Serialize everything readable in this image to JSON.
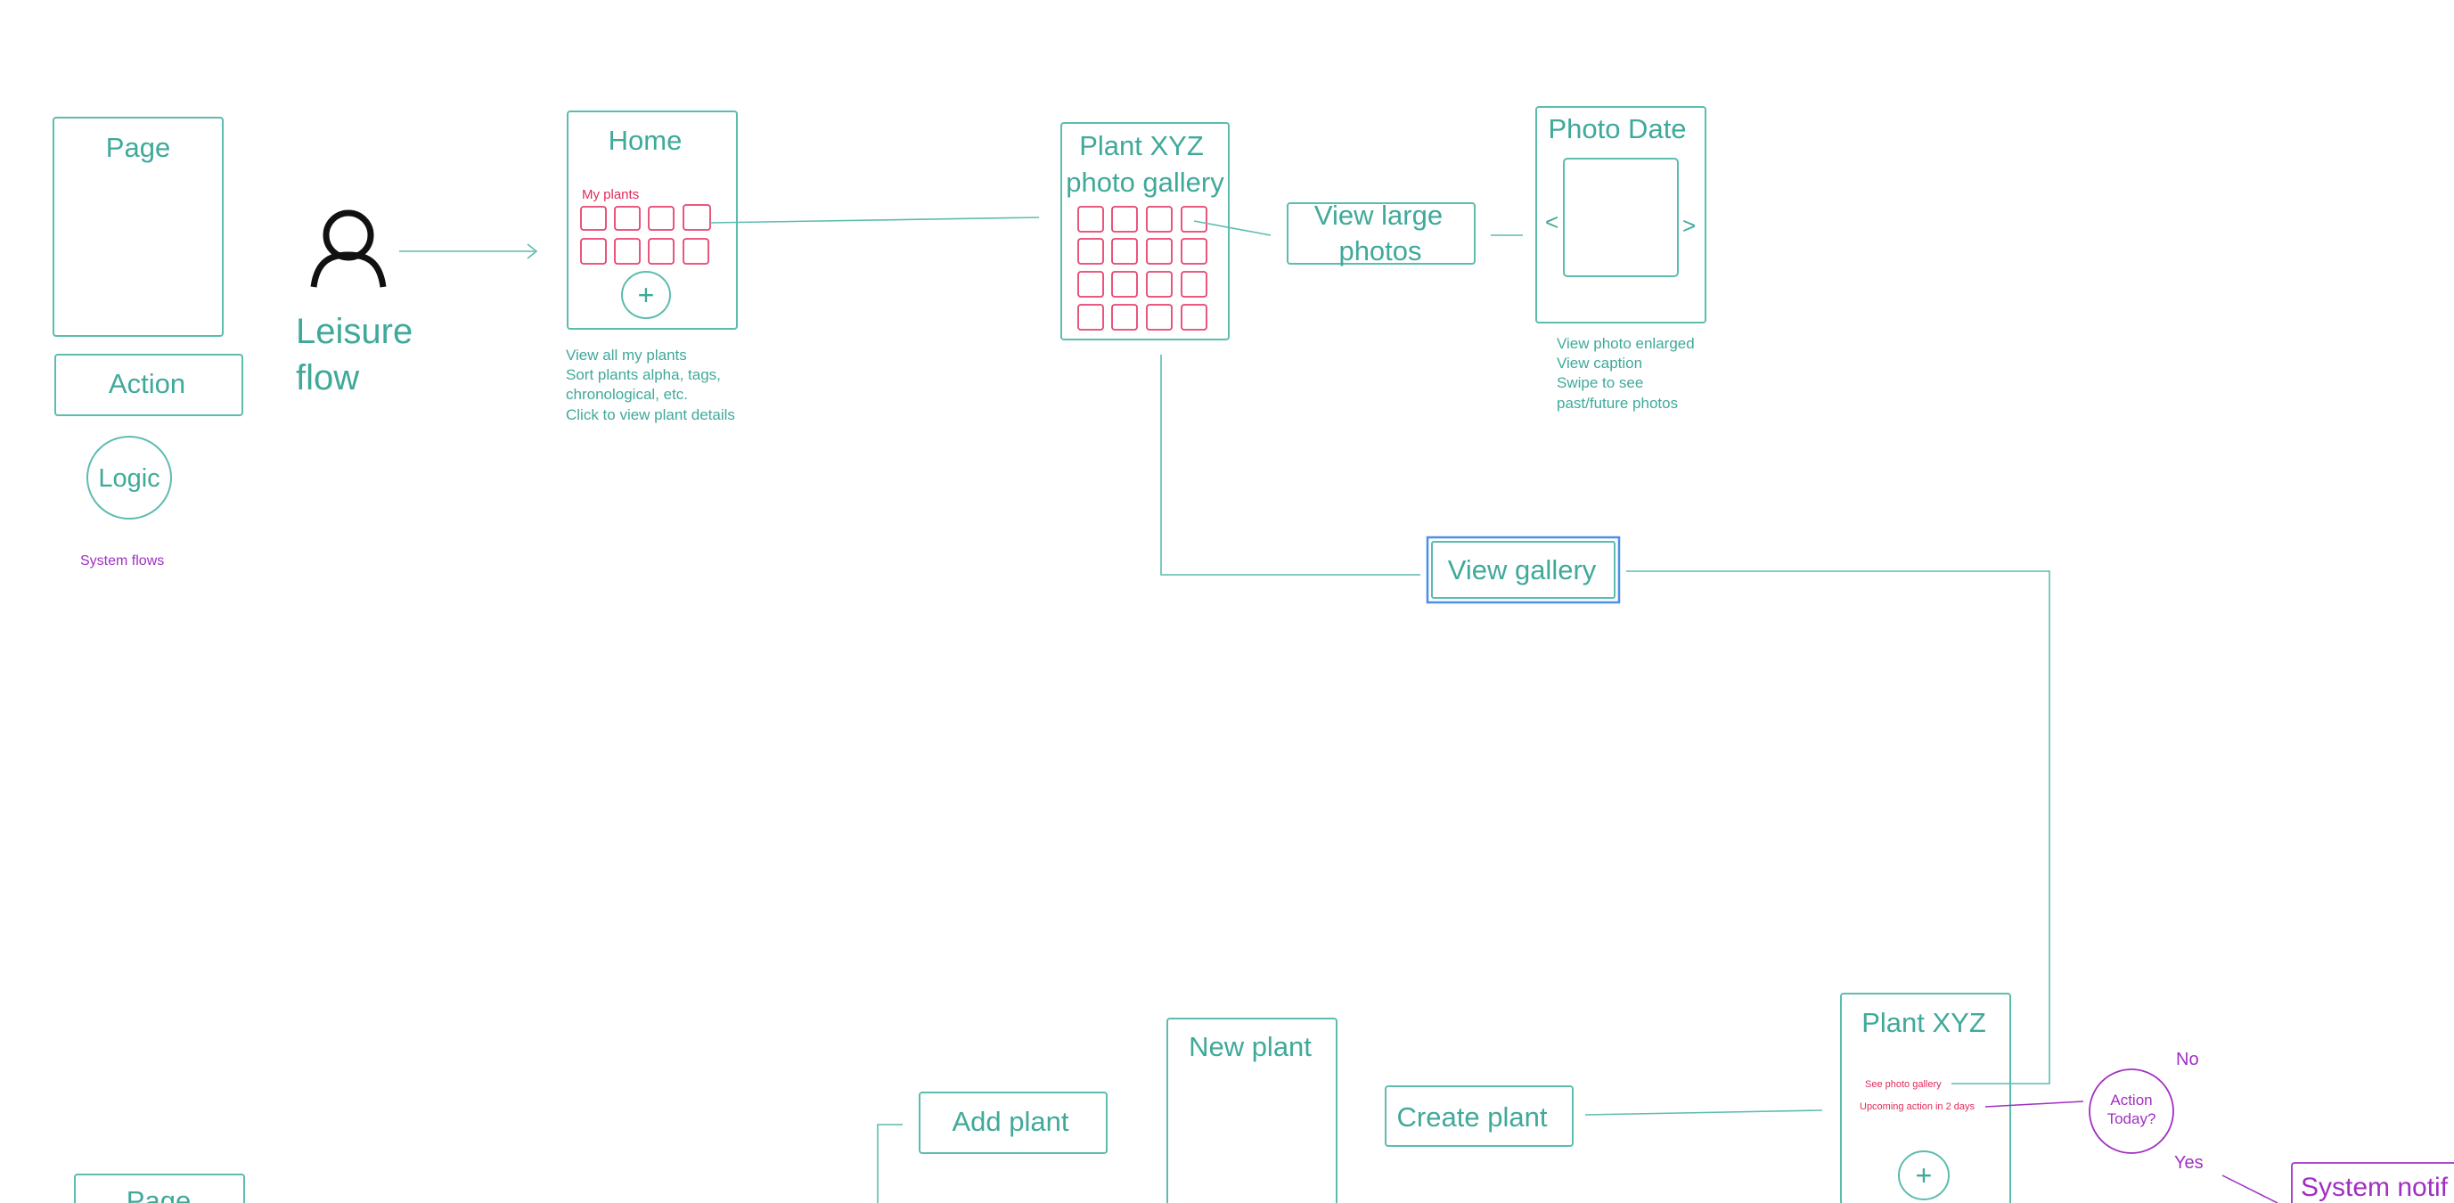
{
  "legend": {
    "page_label": "Page",
    "action_label": "Action",
    "logic_label": "Logic",
    "system_flows_label": "System flows"
  },
  "persona": {
    "label_line1": "Leisure",
    "label_line2": "flow"
  },
  "home": {
    "title": "Home",
    "section_label": "My plants",
    "add_symbol": "+",
    "notes": [
      "View all my plants",
      "Sort plants alpha, tags,",
      "chronological, etc.",
      "Click to view plant details"
    ]
  },
  "gallery": {
    "title_line1": "Plant XYZ",
    "title_line2": "photo gallery"
  },
  "view_large": {
    "line1": "View large",
    "line2": "photos"
  },
  "photo_date": {
    "title": "Photo Date",
    "prev": "<",
    "next": ">",
    "notes": [
      "View photo enlarged",
      "View caption",
      "Swipe to see",
      "past/future photos"
    ]
  },
  "view_gallery": {
    "label": "View gallery"
  },
  "plant_xyz": {
    "title": "Plant XYZ",
    "link1": "See photo gallery",
    "link2": "Upcoming action in 2 days",
    "add_symbol": "+"
  },
  "decision": {
    "line1": "Action",
    "line2": "Today?",
    "no_label": "No",
    "yes_label": "Yes"
  },
  "system_notif": {
    "label": "System notif"
  },
  "new_plant": {
    "title": "New plant"
  },
  "create_plant": {
    "label": "Create plant"
  },
  "add_plant": {
    "label": "Add plant"
  },
  "legend_bottom": {
    "page_label": "Page"
  },
  "colors": {
    "teal": "#3fa99a",
    "pink": "#e02a5c",
    "purple": "#a12fc2",
    "blue_selection": "#4a8fe8"
  }
}
